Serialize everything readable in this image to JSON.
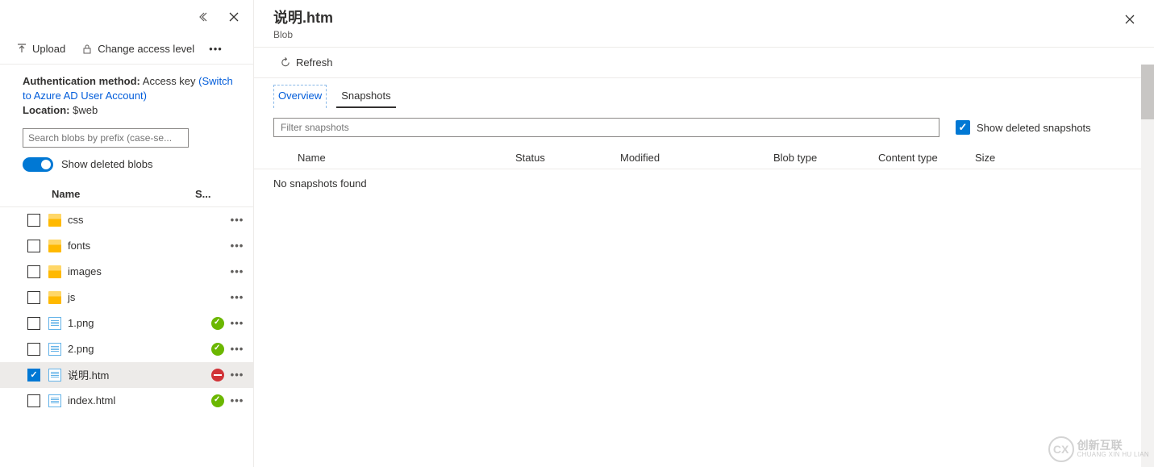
{
  "left": {
    "toolbar": {
      "upload": "Upload",
      "change_access": "Change access level"
    },
    "info": {
      "auth_label": "Authentication method:",
      "auth_value": "Access key",
      "switch_link": "(Switch to Azure AD User Account)",
      "location_label": "Location:",
      "location_value": "$web"
    },
    "search_placeholder": "Search blobs by prefix (case-se...",
    "toggle_label": "Show deleted blobs",
    "columns": {
      "name": "Name",
      "status": "S..."
    },
    "files": [
      {
        "name": "css",
        "type": "folder",
        "status": "",
        "checked": false
      },
      {
        "name": "fonts",
        "type": "folder",
        "status": "",
        "checked": false
      },
      {
        "name": "images",
        "type": "folder",
        "status": "",
        "checked": false
      },
      {
        "name": "js",
        "type": "folder",
        "status": "",
        "checked": false
      },
      {
        "name": "1.png",
        "type": "file",
        "status": "ok",
        "checked": false
      },
      {
        "name": "2.png",
        "type": "file",
        "status": "ok",
        "checked": false
      },
      {
        "name": "说明.htm",
        "type": "file",
        "status": "blocked",
        "checked": true
      },
      {
        "name": "index.html",
        "type": "file",
        "status": "ok",
        "checked": false
      }
    ]
  },
  "right": {
    "title": "说明.htm",
    "subtitle": "Blob",
    "refresh": "Refresh",
    "tabs": {
      "overview": "Overview",
      "snapshots": "Snapshots"
    },
    "filter_placeholder": "Filter snapshots",
    "show_deleted": "Show deleted snapshots",
    "columns": {
      "name": "Name",
      "status": "Status",
      "modified": "Modified",
      "blobtype": "Blob type",
      "contenttype": "Content type",
      "size": "Size"
    },
    "empty": "No snapshots found"
  },
  "watermark": {
    "cn": "创新互联",
    "py": "CHUANG XIN HU LIAN"
  }
}
